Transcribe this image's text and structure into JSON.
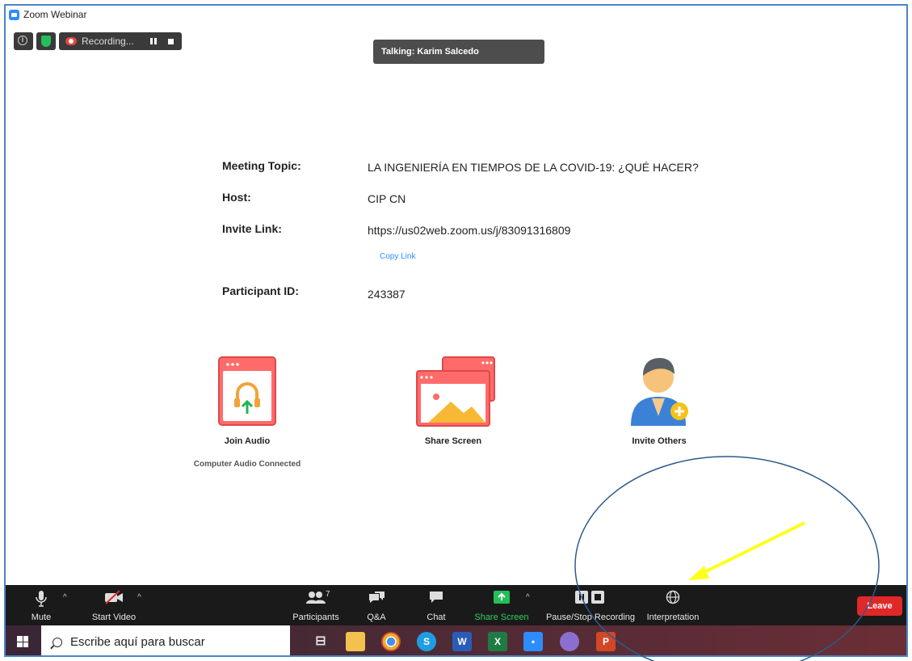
{
  "window": {
    "title": "Zoom Webinar"
  },
  "top_controls": {
    "recording_label": "Recording..."
  },
  "talking_banner": "Talking: Karim Salcedo",
  "meeting": {
    "topic_label": "Meeting Topic:",
    "topic_value": "LA INGENIERÍA EN TIEMPOS DE LA COVID-19: ¿QUÉ HACER?",
    "host_label": "Host:",
    "host_value": "CIP CN",
    "invite_label": "Invite Link:",
    "invite_value": "https://us02web.zoom.us/j/83091316809",
    "copy_link": "Copy Link",
    "participant_label": "Participant ID:",
    "participant_value": "243387"
  },
  "actions": {
    "join_audio": "Join Audio",
    "join_audio_sub": "Computer Audio Connected",
    "share_screen": "Share Screen",
    "invite_others": "Invite Others"
  },
  "toolbar": {
    "mute": "Mute",
    "start_video": "Start Video",
    "participants": "Participants",
    "participants_count": "7",
    "qa": "Q&A",
    "chat": "Chat",
    "share_screen": "Share Screen",
    "pause_stop_recording": "Pause/Stop Recording",
    "interpretation": "Interpretation",
    "leave": "Leave"
  },
  "taskbar": {
    "search_placeholder": "Escribe aquí para buscar",
    "apps": [
      "task-view",
      "file-explorer",
      "chrome",
      "skype",
      "word",
      "excel",
      "zoom",
      "snipping-tool",
      "powerpoint"
    ]
  },
  "colors": {
    "zoom_blue": "#2d8cff",
    "share_green": "#23c05a",
    "leave_red": "#e02828",
    "annotation_circle": "#2e5a8c",
    "annotation_arrow": "#ffff1a"
  }
}
